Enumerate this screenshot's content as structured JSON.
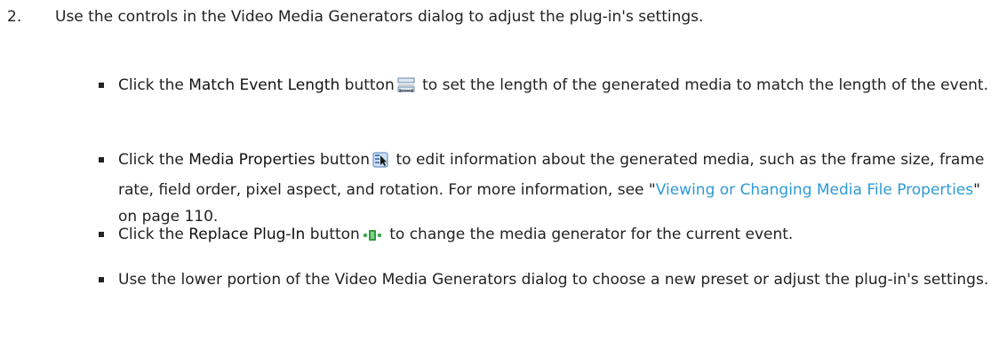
{
  "step": {
    "number": "2.",
    "text": "Use the controls in the Video Media Generators dialog to adjust the plug-in's settings."
  },
  "bullets": [
    {
      "pre": "Click the ",
      "term": "Match Event Length",
      "mid": " button",
      "icon": "match-event-length-icon",
      "post": " to set the length of the generated media to match the length of the event."
    },
    {
      "pre": "Click the ",
      "term": "Media Properties",
      "mid": " button",
      "icon": "media-properties-icon",
      "post": " to edit information about the generated media, such as the frame size, frame rate, field order, pixel aspect, and rotation. For more information, see \"",
      "link": "Viewing or Changing Media File Properties",
      "after_link": "\" on page 110."
    },
    {
      "pre": "Click the ",
      "term": "Replace Plug-In",
      "mid": " button",
      "icon": "replace-plug-in-icon",
      "post": " to change the media generator for the current event."
    },
    {
      "text": "Use the lower portion of the Video Media Generators dialog to choose a new preset or adjust the plug-in's settings."
    }
  ],
  "colors": {
    "text": "#222222",
    "link": "#2e9ad6"
  }
}
